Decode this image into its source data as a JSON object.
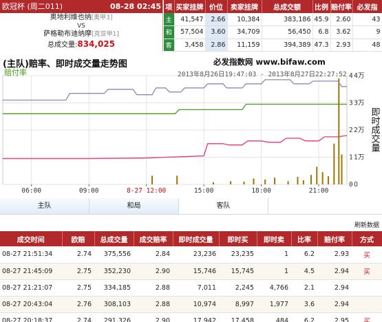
{
  "match": {
    "league": "欧冠杯 (周二011)",
    "time": "08-28 02:45",
    "home_team": "奥地利维也纳",
    "home_tag": "[奥甲3]",
    "vs": "VS",
    "away_team": "萨格勒布迪纳摩",
    "away_tag": "[克亚甲1]",
    "volume_label": "总成交量:",
    "volume_value": "834,025"
  },
  "odds_table": {
    "headers": [
      "项",
      "买家挂牌",
      "价位",
      "卖家挂牌",
      "总成交额",
      "比例",
      "赔付率",
      "必发指"
    ],
    "rows": [
      [
        "主",
        "41,547",
        "2.66",
        "10,384",
        "383,186",
        "45.9",
        "2.60",
        "43"
      ],
      [
        "和",
        "57,504",
        "3.60",
        "34,709",
        "56,450",
        "6.8",
        "3.62",
        "9"
      ],
      [
        "客",
        "3,458",
        "2.86",
        "11,159",
        "394,389",
        "47.3",
        "2.93",
        "48"
      ]
    ]
  },
  "chart": {
    "title": "(主队)赔率、即时成交量走势图",
    "site": "必发指数网 www.bifaw.com",
    "series_label": "赔付率",
    "range": "2013年8月26日19:47:03 - 2013年8月27日22:27:52",
    "right_axis_title": "即时成交量",
    "colors": {
      "purple": "#8a8ab4",
      "green": "#4a9a1e",
      "pink": "#e8356e",
      "bar": "#a07400"
    }
  },
  "chart_data": {
    "type": "line",
    "title": "(主队)赔率、即时成交量走势图",
    "x_ticks": [
      "06:00",
      "09:00",
      "8-27 12:00",
      "15:00",
      "18:00",
      "21:00"
    ],
    "left_ticks": [
      0,
      1,
      2,
      3,
      4
    ],
    "right_ticks": [
      "0",
      "1万",
      "2万",
      "3万",
      "4万"
    ],
    "ylabel_right": "即时成交量",
    "x_range": [
      4.5,
      22.47
    ],
    "left_range": [
      0,
      4
    ],
    "series": [
      {
        "name": "",
        "x": [
          4.5,
          7.8,
          8.0,
          9.8,
          10.0,
          11.3,
          11.5,
          12.3,
          12.5,
          13.0,
          13.2,
          13.8,
          14.0,
          15.0,
          15.2,
          16.0,
          16.2,
          17.0,
          17.2,
          18.0,
          18.2,
          19.5,
          19.7,
          20.5,
          20.7,
          22.0,
          22.2,
          22.47
        ],
        "y": [
          3.1,
          3.1,
          3.35,
          3.35,
          3.5,
          3.5,
          3.3,
          3.3,
          3.55,
          3.55,
          3.4,
          3.4,
          3.55,
          3.55,
          3.7,
          3.7,
          3.55,
          3.55,
          3.7,
          3.7,
          3.85,
          3.85,
          3.7,
          3.7,
          3.8,
          3.8,
          3.6,
          3.6
        ]
      },
      {
        "name": "",
        "x": [
          4.5,
          13.5,
          13.7,
          17.0,
          17.2,
          22.47
        ],
        "y": [
          2.6,
          2.6,
          2.75,
          2.75,
          2.95,
          2.95
        ]
      },
      {
        "name": "",
        "x": [
          4.5,
          9.0,
          12.0,
          13.0,
          14.0,
          15.0,
          15.2,
          16.0,
          16.3,
          17.0,
          17.3,
          18.0,
          18.4,
          19.0,
          19.3,
          20.0,
          20.3,
          21.0,
          21.3,
          22.0,
          22.47
        ],
        "y": [
          0.95,
          0.95,
          0.97,
          1.0,
          1.02,
          1.05,
          1.5,
          1.5,
          1.45,
          1.45,
          1.6,
          1.6,
          1.55,
          1.55,
          1.7,
          1.7,
          1.6,
          1.6,
          1.75,
          1.75,
          1.8
        ]
      }
    ],
    "bars": {
      "x": [
        12.3,
        13.6,
        15.5,
        16.4,
        17.1,
        17.6,
        18.2,
        18.7,
        19.4,
        19.9,
        20.2,
        20.6,
        20.9,
        21.2,
        21.5,
        21.8,
        22.05,
        22.2
      ],
      "y": [
        0.32,
        0.32,
        0.08,
        0.12,
        0.1,
        0.22,
        0.18,
        0.25,
        0.12,
        0.28,
        0.15,
        0.35,
        0.65,
        0.45,
        0.3,
        1.5,
        3.9,
        1.1
      ]
    }
  },
  "tabs": [
    "主队",
    "和局",
    "客队"
  ],
  "refresh_label": "刷新数据",
  "trades": {
    "headers": [
      "成交时间",
      "欧赔",
      "总成交量",
      "成交赔率",
      "即时成交量",
      "即时买",
      "即时卖",
      "比率",
      "赔付率",
      "方式"
    ],
    "rows": [
      [
        "08-27 21:51:34",
        "2.74",
        "375,556",
        "2.84",
        "23,236",
        "23,235",
        "1",
        "6.2",
        "2.93",
        "买"
      ],
      [
        "08-27 21:45:09",
        "2.75",
        "352,230",
        "2.90",
        "15,746",
        "15,745",
        "1",
        "4.5",
        "2.94",
        "买"
      ],
      [
        "08-27 21:21:07",
        "2.75",
        "334,185",
        "2.88",
        "7,011",
        "2,245",
        "4,766",
        "2.1",
        "2.94",
        ""
      ],
      [
        "08-27 20:43:04",
        "2.76",
        "308,103",
        "2.88",
        "10,974",
        "8,997",
        "1,977",
        "3.6",
        "2.94",
        ""
      ],
      [
        "08-27 20:18:37",
        "2.74",
        "291,326",
        "2.90",
        "17,942",
        "17,458",
        "484",
        "6.2",
        "2.95",
        "买"
      ]
    ]
  }
}
